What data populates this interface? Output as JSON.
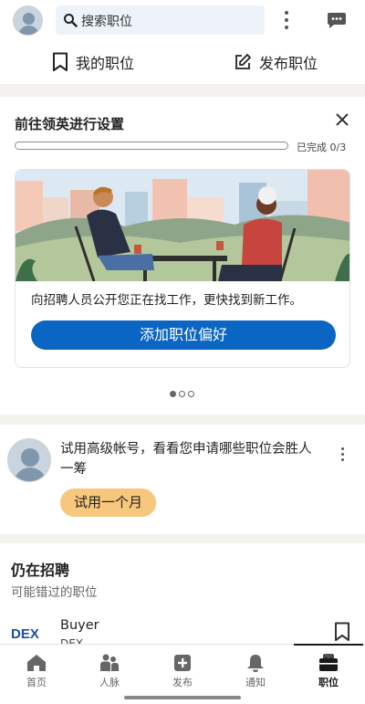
{
  "search": {
    "placeholder": "搜索职位"
  },
  "subnav": {
    "my_jobs": "我的职位",
    "post_job": "发布职位"
  },
  "setup": {
    "title": "前往领英进行设置",
    "progress_label": "已完成 0/3",
    "progress": 0,
    "description": "向招聘人员公开您正在找工作，更快找到新工作。",
    "button": "添加职位偏好",
    "pager": {
      "total": 3,
      "active": 1
    }
  },
  "premium": {
    "text": "试用高级帐号，看看您申请哪些职位会胜人一筹",
    "button": "试用一个月"
  },
  "still_hiring": {
    "title": "仍在招聘",
    "subtitle": "可能错过的职位",
    "job_title": "Buyer",
    "company": "DEX",
    "logo_text": "DEX"
  },
  "nav": {
    "home": "首页",
    "network": "人脉",
    "post": "发布",
    "notifications": "通知",
    "jobs": "职位"
  },
  "colors": {
    "primary": "#0a66c2",
    "premium": "#f8c77e"
  }
}
